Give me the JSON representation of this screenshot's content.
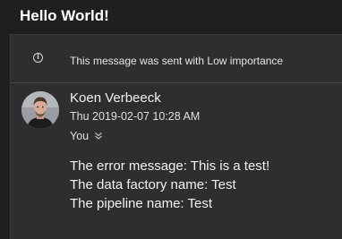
{
  "subject": "Hello World!",
  "info_bar": {
    "icon": "info-circle-icon",
    "message": "This message was sent with Low importance"
  },
  "sender": {
    "name": "Koen Verbeeck",
    "timestamp": "Thu 2019-02-07 10:28 AM",
    "recipients": "You",
    "avatar": "person-photo"
  },
  "body": [
    "The error message: This is a test!",
    "The data factory name: Test",
    "The pipeline name: Test"
  ],
  "colors": {
    "background": "#1f1f1f",
    "card": "#2e2e2e",
    "text": "#f2f2f2"
  }
}
